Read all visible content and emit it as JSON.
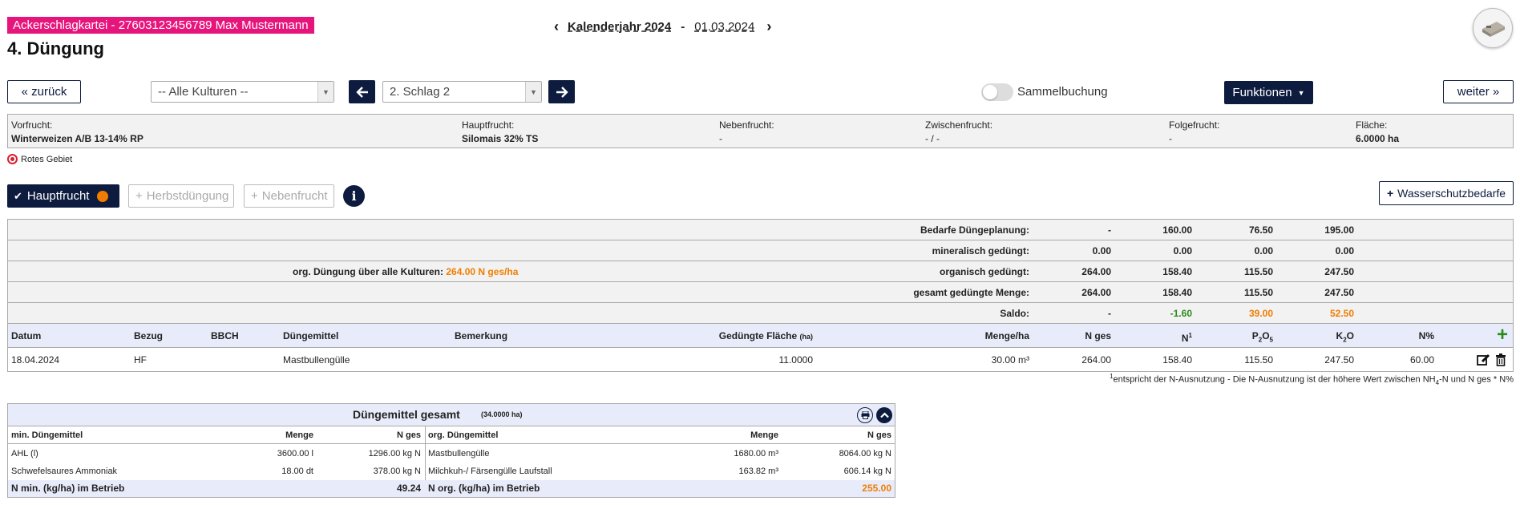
{
  "header": {
    "badge": "Ackerschlagkartei - 27603123456789 Max Mustermann",
    "title": "4. Düngung",
    "calendar_year": "Kalenderjahr 2024",
    "calendar_sep": "-",
    "calendar_date": "01.03.2024"
  },
  "toolbar": {
    "back_label": "«  zurück",
    "kulturen_select": "-- Alle Kulturen --",
    "schlag_select": "2. Schlag 2",
    "sammelbuchung_label": "Sammelbuchung",
    "funktionen_label": "Funktionen",
    "next_label": "weiter  »"
  },
  "info": {
    "vorfrucht_label": "Vorfrucht:",
    "vorfrucht_value": "Winterweizen A/B 13-14% RP",
    "hauptfrucht_label": "Hauptfrucht:",
    "hauptfrucht_value": "Silomais 32% TS",
    "nebenfrucht_label": "Nebenfrucht:",
    "nebenfrucht_value": "-",
    "zwischenfrucht_label": "Zwischenfrucht:",
    "zwischenfrucht_value": "- / -",
    "folgefrucht_label": "Folgefrucht:",
    "folgefrucht_value": "-",
    "flaeche_label": "Fläche:",
    "flaeche_value": "6.0000 ha",
    "rotes_gebiet": "Rotes Gebiet"
  },
  "tabs": {
    "hauptfrucht": "Hauptfrucht",
    "herbstduengung": "Herbstdüngung",
    "nebenfrucht": "Nebenfrucht",
    "wasserschutz": "Wasserschutzbedarfe",
    "info_glyph": "i"
  },
  "summary_rows": [
    {
      "label": "Bedarfe Düngeplanung:",
      "v1": "-",
      "v2": "160.00",
      "v3": "76.50",
      "v4": "195.00"
    },
    {
      "label": "mineralisch gedüngt:",
      "v1": "0.00",
      "v2": "0.00",
      "v3": "0.00",
      "v4": "0.00"
    },
    {
      "label": "organisch gedüngt:",
      "v1": "264.00",
      "v2": "158.40",
      "v3": "115.50",
      "v4": "247.50"
    },
    {
      "label": "gesamt gedüngte Menge:",
      "v1": "264.00",
      "v2": "158.40",
      "v3": "115.50",
      "v4": "247.50"
    },
    {
      "label": "Saldo:",
      "v1": "-",
      "v2": "-1.60",
      "v3": "39.00",
      "v4": "52.50"
    }
  ],
  "org_all": {
    "label": "org. Düngung über alle Kulturen:",
    "value": "264.00 N ges/ha"
  },
  "columns": {
    "datum": "Datum",
    "bezug": "Bezug",
    "bbch": "BBCH",
    "duengemittel": "Düngemittel",
    "bemerkung": "Bemerkung",
    "flaeche": "Gedüngte Fläche",
    "flaeche_unit": "(ha)",
    "menge": "Menge/ha",
    "nges": "N ges",
    "n1": "N",
    "n1_sup": "1",
    "p": "P",
    "p_sub1": "2",
    "o": "O",
    "p_sub2": "5",
    "k": "K",
    "k_sub": "2",
    "ko": "O",
    "npct": "N%"
  },
  "rows": [
    {
      "datum": "18.04.2024",
      "bezug": "HF",
      "bbch": "",
      "duengemittel": "Mastbullengülle",
      "bemerkung": "",
      "flaeche": "11.0000",
      "menge": "30.00 m³",
      "nges": "264.00",
      "n1": "158.40",
      "p2o5": "115.50",
      "k2o": "247.50",
      "npct": "60.00"
    }
  ],
  "footnote": {
    "sup": "1",
    "text_a": "entspricht der N-Ausnutzung - Die N-Ausnutzung ist der höhere Wert zwischen NH",
    "sub": "4",
    "text_b": "-N und N ges * N%"
  },
  "totals": {
    "title": "Düngemittel gesamt",
    "sub": "(34.0000 ha)",
    "min_header": "min. Düngemittel",
    "menge_header": "Menge",
    "nges_header": "N ges",
    "org_header": "org. Düngemittel",
    "min_items": [
      {
        "name": "AHL (l)",
        "menge": "3600.00 l",
        "nges": "1296.00 kg N"
      },
      {
        "name": "Schwefelsaures Ammoniak",
        "menge": "18.00 dt",
        "nges": "378.00 kg N"
      }
    ],
    "org_items": [
      {
        "name": "Mastbullengülle",
        "menge": "1680.00 m³",
        "nges": "8064.00 kg N"
      },
      {
        "name": "Milchkuh-/ Färsengülle Laufstall",
        "menge": "163.82 m³",
        "nges": "606.14 kg N"
      }
    ],
    "min_total_label": "N min. (kg/ha) im Betrieb",
    "min_total": "49.24",
    "org_total_label": "N org. (kg/ha) im Betrieb",
    "org_total": "255.00"
  }
}
